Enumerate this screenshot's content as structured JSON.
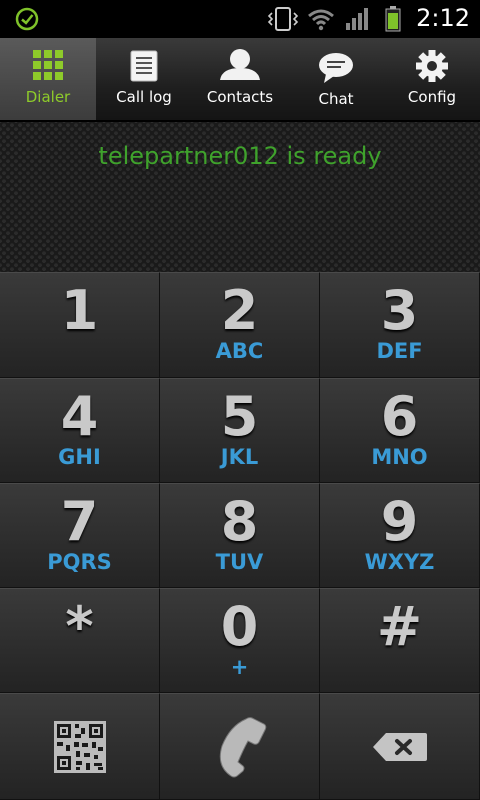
{
  "status_bar": {
    "time": "2:12"
  },
  "tabs": [
    {
      "label": "Dialer",
      "icon": "grid-icon",
      "active": true
    },
    {
      "label": "Call log",
      "icon": "call-log-icon",
      "active": false
    },
    {
      "label": "Contacts",
      "icon": "contacts-icon",
      "active": false
    },
    {
      "label": "Chat",
      "icon": "chat-bubble-icon",
      "active": false
    },
    {
      "label": "Config",
      "icon": "gear-icon",
      "active": false
    }
  ],
  "status_message": "telepartner012 is ready",
  "keypad": {
    "keys": [
      {
        "digit": "1",
        "letters": ""
      },
      {
        "digit": "2",
        "letters": "ABC"
      },
      {
        "digit": "3",
        "letters": "DEF"
      },
      {
        "digit": "4",
        "letters": "GHI"
      },
      {
        "digit": "5",
        "letters": "JKL"
      },
      {
        "digit": "6",
        "letters": "MNO"
      },
      {
        "digit": "7",
        "letters": "PQRS"
      },
      {
        "digit": "8",
        "letters": "TUV"
      },
      {
        "digit": "9",
        "letters": "WXYZ"
      },
      {
        "digit": "*",
        "letters": ""
      },
      {
        "digit": "0",
        "letters": "+"
      },
      {
        "digit": "#",
        "letters": ""
      }
    ],
    "bottom_row": [
      "qr-code-icon",
      "phone-call-icon",
      "backspace-icon"
    ]
  },
  "colors": {
    "accent_green": "#8ecb2a",
    "status_text": "#3fa22c",
    "letters_blue": "#3a9bd6"
  }
}
